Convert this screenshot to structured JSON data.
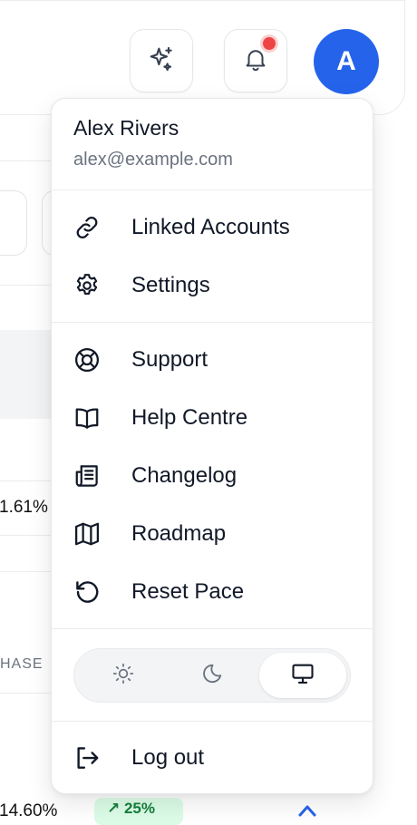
{
  "header": {
    "ai_button": "sparkles-icon",
    "notifications_button": "bell-icon",
    "avatar_initial": "A"
  },
  "background": {
    "stat_value_1": "1.61%",
    "column_label": "HASE",
    "stat_value_2": "14.60%",
    "badge": "↗ 25%",
    "caret": "^"
  },
  "user_menu": {
    "name": "Alex Rivers",
    "email": "alex@example.com",
    "account_items": [
      {
        "label": "Linked Accounts",
        "icon": "link-icon"
      },
      {
        "label": "Settings",
        "icon": "gear-icon"
      }
    ],
    "help_items": [
      {
        "label": "Support",
        "icon": "lifebuoy-icon"
      },
      {
        "label": "Help Centre",
        "icon": "book-open-icon"
      },
      {
        "label": "Changelog",
        "icon": "newspaper-icon"
      },
      {
        "label": "Roadmap",
        "icon": "map-icon"
      },
      {
        "label": "Reset Pace",
        "icon": "rotate-ccw-icon"
      }
    ],
    "theme_toggle": {
      "options": [
        "light",
        "dark",
        "system"
      ],
      "selected": "system"
    },
    "logout_label": "Log out"
  },
  "colors": {
    "accent": "#2563eb",
    "notification": "#ef4444",
    "text_primary": "#111827",
    "text_secondary": "#6b7280"
  }
}
